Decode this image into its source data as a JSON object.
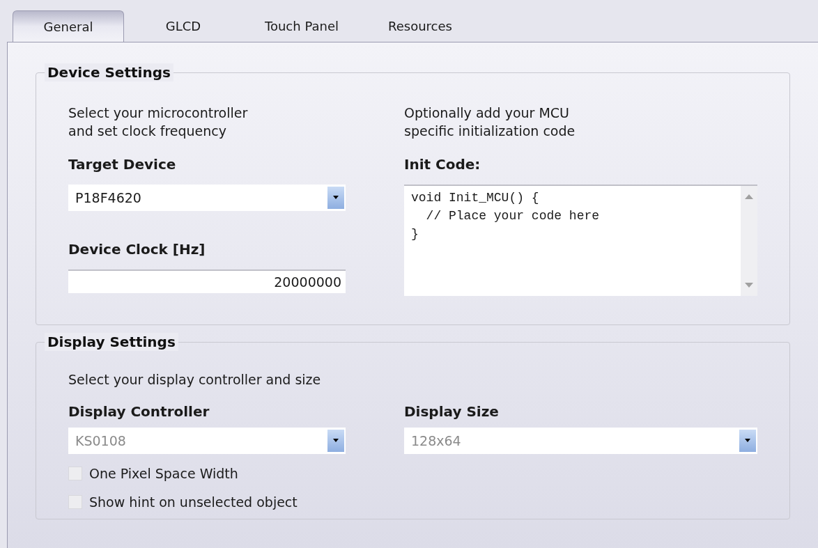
{
  "tabs": [
    {
      "label": "General",
      "selected": true
    },
    {
      "label": "GLCD",
      "selected": false
    },
    {
      "label": "Touch Panel",
      "selected": false
    },
    {
      "label": "Resources",
      "selected": false
    }
  ],
  "device_settings": {
    "title": "Device Settings",
    "left": {
      "description": [
        "Select your microcontroller",
        "and set clock frequency"
      ],
      "target_device": {
        "label": "Target Device",
        "value": "P18F4620",
        "disabled": false
      },
      "device_clock": {
        "label": "Device Clock [Hz]",
        "value": "20000000"
      }
    },
    "right": {
      "description": [
        "Optionally add your MCU",
        "specific initialization code"
      ],
      "init_code": {
        "label": "Init Code:",
        "lines": [
          "void Init_MCU() {",
          "  // Place your code here",
          "}"
        ]
      }
    }
  },
  "display_settings": {
    "title": "Display Settings",
    "description": "Select your display controller and size",
    "display_controller": {
      "label": "Display Controller",
      "value": "KS0108",
      "disabled": true
    },
    "display_size": {
      "label": "Display Size",
      "value": "128x64",
      "disabled": true
    },
    "options": [
      {
        "label": "One Pixel Space Width",
        "checked": false
      },
      {
        "label": "Show hint on unselected object",
        "checked": false
      }
    ]
  }
}
